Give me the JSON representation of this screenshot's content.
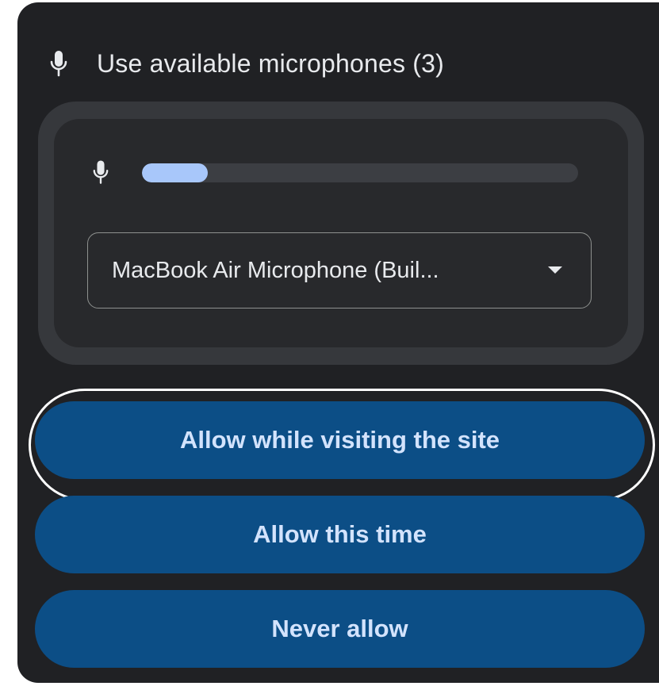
{
  "header": {
    "icon": "microphone-icon",
    "label": "Use available microphones (3)"
  },
  "device": {
    "icon": "microphone-icon",
    "level_fraction": 0.15,
    "selected": "MacBook Air Microphone (Buil...",
    "level_color": "#a8c7fa"
  },
  "actions": {
    "allow_while_visiting": "Allow while visiting the site",
    "allow_this_time": "Allow this time",
    "never_allow": "Never allow"
  },
  "colors": {
    "background": "#202124",
    "button": "#0c4e86",
    "button_text": "#d3e3fd"
  }
}
